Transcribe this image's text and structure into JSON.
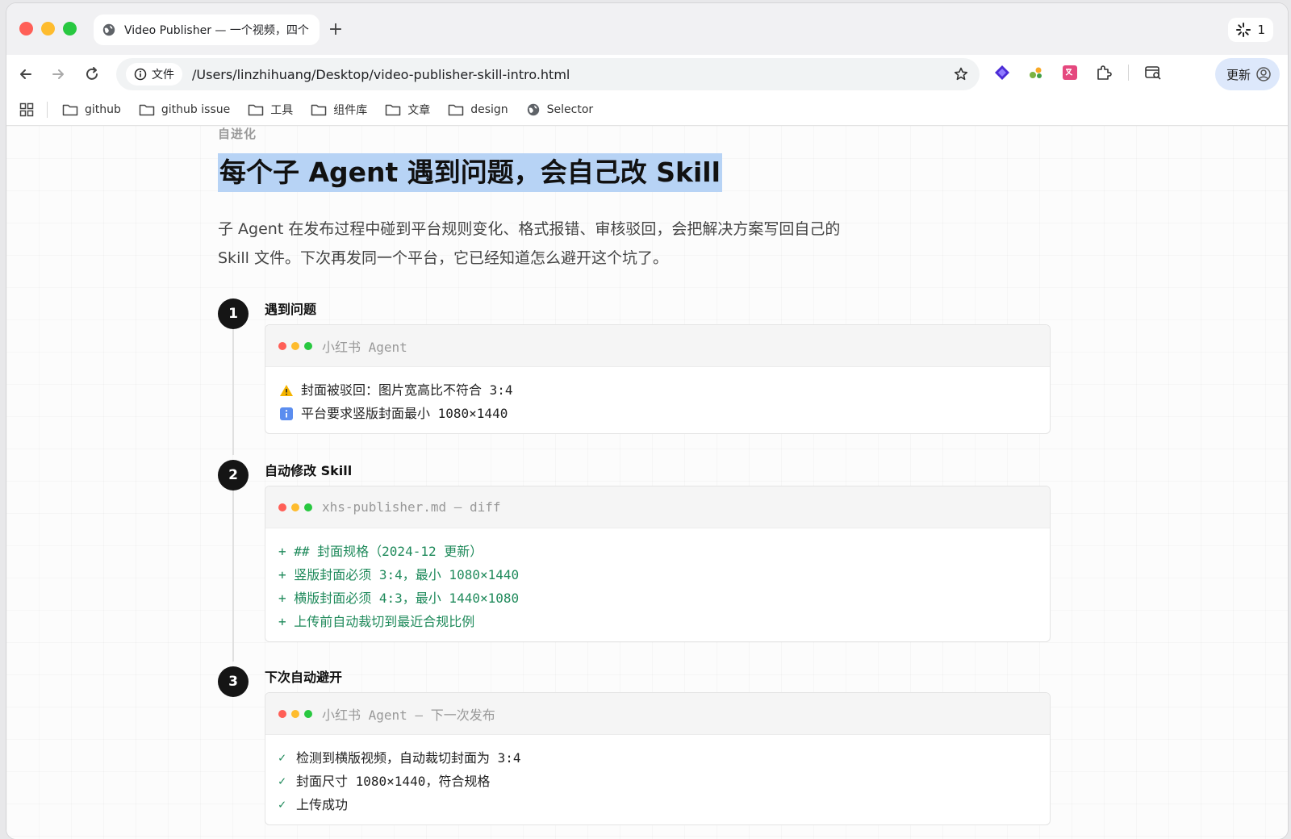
{
  "browser": {
    "tab_title": "Video Publisher — 一个视频，四个",
    "new_tab_label": "+",
    "tabstrip_badge": "1",
    "site_chip_label": "文件",
    "url": "/Users/linzhihuang/Desktop/video-publisher-skill-intro.html",
    "update_label": "更新"
  },
  "bookmarks": [
    {
      "label": "github",
      "icon": "folder-icon"
    },
    {
      "label": "github issue",
      "icon": "folder-icon"
    },
    {
      "label": "工具",
      "icon": "folder-icon"
    },
    {
      "label": "组件库",
      "icon": "folder-icon"
    },
    {
      "label": "文章",
      "icon": "folder-icon"
    },
    {
      "label": "design",
      "icon": "folder-icon"
    },
    {
      "label": "Selector",
      "icon": "globe-icon"
    }
  ],
  "page": {
    "eyebrow": "自进化",
    "headline": "每个子 Agent 遇到问题，会自己改 Skill",
    "lead": "子 Agent 在发布过程中碰到平台规则变化、格式报错、审核驳回，会把解决方案写回自己的 Skill 文件。下次再发同一个平台，它已经知道怎么避开这个坑了。",
    "steps": [
      {
        "number": "1",
        "title": "遇到问题",
        "card_title": "小红书 Agent",
        "lines": [
          {
            "icon": "warning-icon",
            "text": "封面被驳回：图片宽高比不符合 3:4"
          },
          {
            "icon": "info-icon",
            "text": "平台要求竖版封面最小 1080×1440"
          }
        ]
      },
      {
        "number": "2",
        "title": "自动修改 Skill",
        "card_title": "xhs-publisher.md — diff",
        "lines": [
          {
            "text": "+ ## 封面规格（2024-12 更新）"
          },
          {
            "text": "+ 竖版封面必须 3:4，最小 1080×1440"
          },
          {
            "text": "+ 横版封面必须 4:3，最小 1440×1080"
          },
          {
            "text": "+ 上传前自动裁切到最近合规比例"
          }
        ]
      },
      {
        "number": "3",
        "title": "下次自动避开",
        "card_title": "小红书 Agent — 下一次发布",
        "lines": [
          {
            "icon": "check-icon",
            "mark": "✓",
            "text": "检测到横版视频，自动裁切封面为 3:4"
          },
          {
            "icon": "check-icon",
            "mark": "✓",
            "text": "封面尺寸 1080×1440，符合规格"
          },
          {
            "icon": "check-icon",
            "mark": "✓",
            "text": "上传成功"
          }
        ]
      }
    ]
  },
  "colors": {
    "headline_highlight": "#b7d3f5",
    "diff_green": "#1f8a5b",
    "step_badge": "#151515"
  }
}
